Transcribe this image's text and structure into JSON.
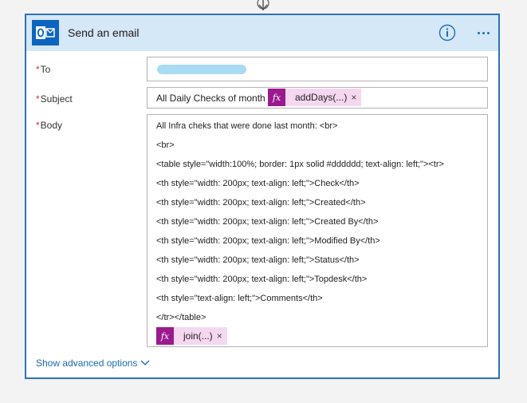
{
  "card": {
    "title": "Send an email",
    "accent": "#2d73b8",
    "header_bg": "#d5e8f7",
    "icons": [
      "outlook-icon",
      "info-icon",
      "more-icon"
    ]
  },
  "fields": {
    "to": {
      "label": "To",
      "required_mark": "*",
      "value": ""
    },
    "subject": {
      "label": "Subject",
      "required_mark": "*",
      "text": "All Daily Checks of month",
      "token": {
        "fx": "fx",
        "label": "addDays(...)",
        "close": "×"
      }
    },
    "body": {
      "label": "Body",
      "required_mark": "*",
      "lines": [
        "All Infra cheks that were done last month: <br>",
        "<br>",
        "<table style=\"width:100%; border: 1px solid #dddddd; text-align: left;\"><tr>",
        "<th style=\"width: 200px; text-align: left;\">Check</th>",
        "<th style=\"width: 200px; text-align: left;\">Created</th>",
        "<th style=\"width: 200px; text-align: left;\">Created By</th>",
        "<th style=\"width: 200px; text-align: left;\">Modified By</th>",
        "<th style=\"width: 200px; text-align: left;\">Status</th>",
        "<th style=\"width: 200px; text-align: left;\">Topdesk</th>",
        "<th style=\"text-align: left;\">Comments</th>",
        "</tr></table>"
      ],
      "token": {
        "fx": "fx",
        "label": "join(...)",
        "close": "×"
      }
    }
  },
  "advanced": {
    "label": "Show advanced options"
  },
  "colors": {
    "token_bg": "#f5d7ef",
    "fx_bg": "#9b1a8f",
    "required": "#d13438",
    "link": "#1b6ab6"
  }
}
